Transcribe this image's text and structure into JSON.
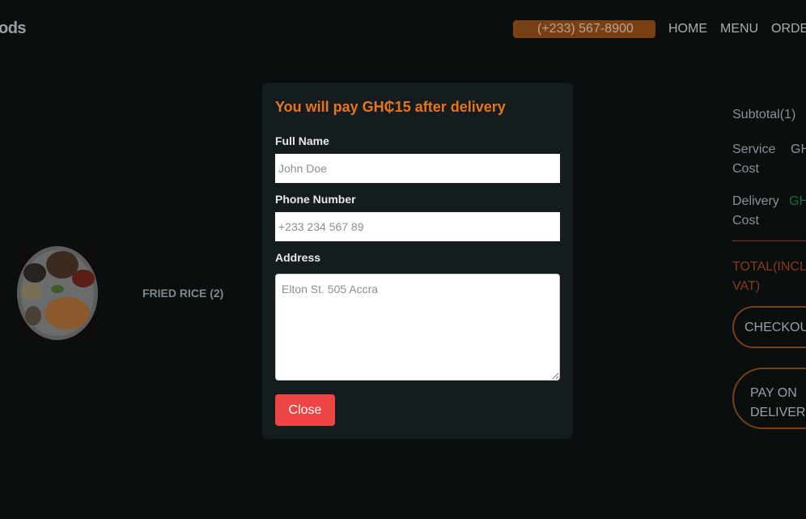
{
  "nav": {
    "brand": "ods",
    "phone": "(+233) 567-8900",
    "links": [
      "HOME",
      "MENU",
      "ORDE"
    ]
  },
  "cart": {
    "item_name": "FRIED RICE (2)"
  },
  "summary": {
    "subtotal_label": "Subtotal(1)",
    "service_label": "Service Cost",
    "service_value": "GH",
    "delivery_label": "Delivery Cost",
    "delivery_value": "GH",
    "total_label": "TOTAL(INCL VAT)",
    "checkout_label": "CHECKOU",
    "pay_on_delivery_label": "PAY ON DELIVERY"
  },
  "modal": {
    "title": "You will pay GH₵15 after delivery",
    "full_name_label": "Full Name",
    "full_name_placeholder": "John Doe",
    "phone_label": "Phone Number",
    "phone_placeholder": "+233 234 567 89",
    "address_label": "Address",
    "address_placeholder": "Elton St. 505 Accra",
    "close_label": "Close"
  },
  "colors": {
    "accent": "#e6761e",
    "close_button": "#ef4444",
    "background": "#090e0f",
    "modal": "#151c1f"
  },
  "icons": {
    "phone": "phone-icon"
  }
}
